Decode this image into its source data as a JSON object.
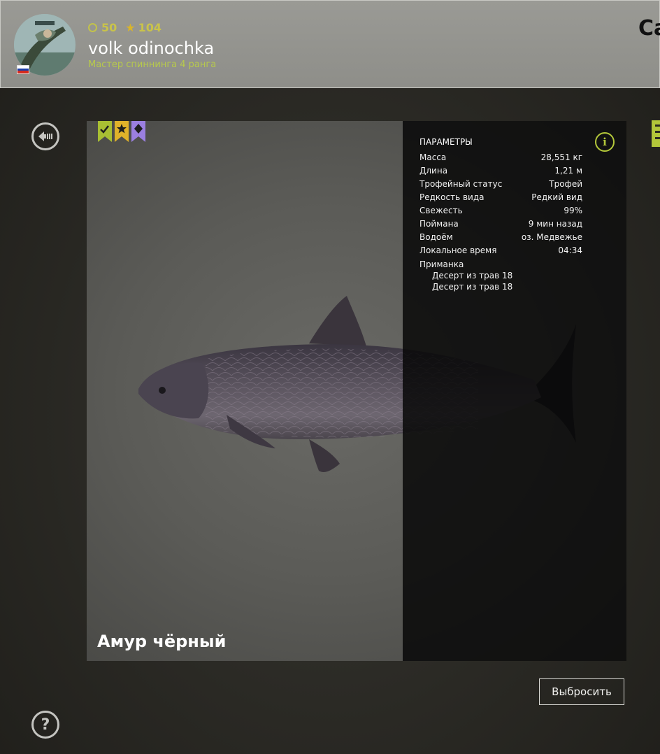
{
  "header": {
    "coins": "50",
    "stars": "104",
    "username": "volk odinochka",
    "rank": "Мастер спиннинга 4 ранга",
    "corner_text": "Са",
    "flag_colors": [
      "#ffffff",
      "#1c3fa8",
      "#d52b1e"
    ]
  },
  "nav": {
    "back_icon": "back-arrow-icon",
    "help_icon": "question-icon",
    "help_glyph": "?"
  },
  "card": {
    "ribbons": [
      {
        "icon": "check-icon",
        "color": "#a8bf33"
      },
      {
        "icon": "star-icon",
        "color": "#e0b22a"
      },
      {
        "icon": "diamond-icon",
        "color": "#9b7fe0"
      }
    ],
    "fish_name": "Амур чёрный",
    "params": {
      "title": "ПАРАМЕТРЫ",
      "info_glyph": "i",
      "rows": [
        {
          "label": "Масса",
          "value": "28,551 кг"
        },
        {
          "label": "Длина",
          "value": "1,21 м"
        },
        {
          "label": "Трофейный статус",
          "value": "Трофей"
        },
        {
          "label": "Редкость вида",
          "value": "Редкий вид"
        },
        {
          "label": "Свежесть",
          "value": "99%"
        },
        {
          "label": "Поймана",
          "value": "9 мин назад"
        },
        {
          "label": "Водоём",
          "value": "оз. Медвежье"
        },
        {
          "label": "Локальное время",
          "value": "04:34"
        }
      ],
      "bait_label": "Приманка",
      "baits": [
        "Десерт из трав 18",
        "Десерт из трав 18"
      ]
    }
  },
  "actions": {
    "discard_label": "Выбросить"
  },
  "colors": {
    "accent": "#b3c73a",
    "panel": "#0a0a0a"
  }
}
